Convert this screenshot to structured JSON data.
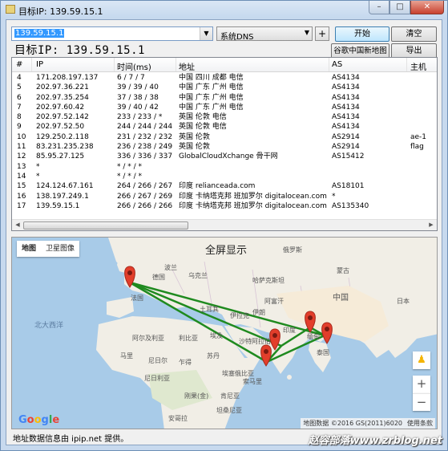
{
  "window": {
    "title": "目标IP: 139.59.15.1"
  },
  "toolbar": {
    "target_value": "139.59.15.1",
    "dns_value": "系统DNS",
    "plus_label": "+",
    "start_label": "开始",
    "clear_label": "清空",
    "map_label": "谷歌中国新地图",
    "export_label": "导出"
  },
  "target_label": "目标IP:  139.59.15.1",
  "table": {
    "columns": [
      "#",
      "IP",
      "时间(ms)",
      "地址",
      "AS",
      "主机"
    ],
    "rows": [
      [
        "4",
        "171.208.197.137",
        "6 / 7 / 7",
        "中国 四川 成都 电信",
        "AS4134",
        ""
      ],
      [
        "5",
        "202.97.36.221",
        "39 / 39 / 40",
        "中国 广东 广州 电信",
        "AS4134",
        ""
      ],
      [
        "6",
        "202.97.35.254",
        "37 / 38 / 38",
        "中国 广东 广州 电信",
        "AS4134",
        ""
      ],
      [
        "7",
        "202.97.60.42",
        "39 / 40 / 42",
        "中国 广东 广州 电信",
        "AS4134",
        ""
      ],
      [
        "8",
        "202.97.52.142",
        "233 / 233 / *",
        "英国 伦敦 电信",
        "AS4134",
        ""
      ],
      [
        "9",
        "202.97.52.50",
        "244 / 244 / 244",
        "英国 伦敦 电信",
        "AS4134",
        ""
      ],
      [
        "10",
        "129.250.2.118",
        "231 / 232 / 232",
        "英国 伦敦",
        "AS2914",
        "ae-1"
      ],
      [
        "11",
        "83.231.235.238",
        "236 / 238 / 249",
        "英国 伦敦",
        "AS2914",
        "flag"
      ],
      [
        "12",
        "85.95.27.125",
        "336 / 336 / 337",
        "GlobalCloudXchange 骨干网",
        "AS15412",
        ""
      ],
      [
        "13",
        "*",
        "* / * / *",
        "",
        "",
        ""
      ],
      [
        "14",
        "*",
        "* / * / *",
        "",
        "",
        ""
      ],
      [
        "15",
        "124.124.67.161",
        "264 / 266 / 267",
        "印度 relianceada.com",
        "AS18101",
        ""
      ],
      [
        "16",
        "138.197.249.1",
        "266 / 267 / 269",
        "印度 卡纳塔克邦 班加罗尔 digitalocean.com",
        "*",
        ""
      ],
      [
        "17",
        "139.59.15.1",
        "266 / 266 / 266",
        "印度 卡纳塔克邦 班加罗尔 digitalocean.com",
        "AS135340",
        ""
      ]
    ]
  },
  "map": {
    "type_map": "地图",
    "type_satellite": "卫星图像",
    "fullscreen": "全屏显示",
    "google": "Google",
    "attribution": "地图数据 ©2016 GS(2011)6020",
    "terms": "使用条款",
    "zoom_in": "+",
    "zoom_out": "−",
    "labels": {
      "russia": "俄罗斯",
      "north_atlantic": "北大西洋",
      "mongolia": "蒙古",
      "kazakhstan": "哈萨克斯坦",
      "china": "中国",
      "iran": "伊朗",
      "india": "印度",
      "france": "法国",
      "ukraine": "乌克兰",
      "turkey": "土耳其",
      "egypt": "埃及",
      "libya": "利比亚",
      "algeria": "阿尔及利亚",
      "mali": "马里",
      "niger": "尼日尔",
      "chad": "乍得",
      "sudan": "苏丹",
      "saudi": "沙特阿拉伯",
      "iraq": "伊拉克",
      "nigeria": "尼日利亚",
      "ethiopia": "埃塞俄比亚",
      "kenya": "肯尼亚",
      "congo": "刚果(金)",
      "tanzania": "坦桑尼亚",
      "angola": "安哥拉",
      "thailand": "泰国",
      "germany": "德国",
      "poland": "波兰",
      "afghanistan": "阿富汗",
      "myanmar": "缅甸",
      "japan": "日本",
      "somalia": "索马里"
    },
    "colors": {
      "route": "#1f8a1f",
      "marker": "#e23e2b",
      "ocean": "#a8cbe8",
      "land": "#f1eee6"
    }
  },
  "footer": "地址数据信息由 ipip.net 提供。",
  "watermark": "赵容部落www.zrblog.net"
}
